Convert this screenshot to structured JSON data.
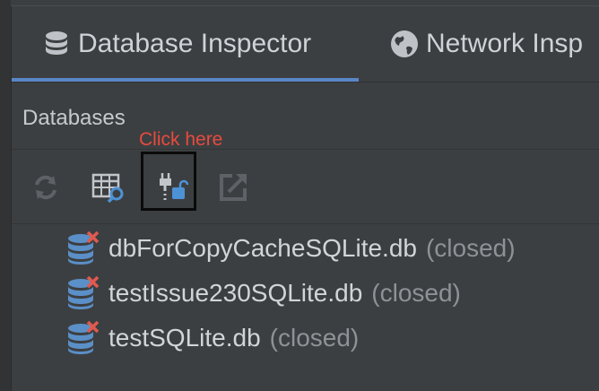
{
  "tabs": [
    {
      "label": "Database Inspector",
      "icon": "database-icon",
      "active": true
    },
    {
      "label": "Network Insp",
      "icon": "globe-icon",
      "active": false
    }
  ],
  "section": {
    "title": "Databases"
  },
  "annotation": {
    "text": "Click here",
    "color": "#e84a3e"
  },
  "toolbar": {
    "buttons": [
      {
        "name": "refresh",
        "icon": "refresh-icon",
        "enabled": false
      },
      {
        "name": "run-query",
        "icon": "table-search-icon",
        "enabled": true
      },
      {
        "name": "keep-connections-open",
        "icon": "plug-unlock-icon",
        "enabled": true
      },
      {
        "name": "export",
        "icon": "export-icon",
        "enabled": false
      }
    ]
  },
  "databases": [
    {
      "name": "dbForCopyCacheSQLite.db",
      "status": "(closed)"
    },
    {
      "name": "testIssue230SQLite.db",
      "status": "(closed)"
    },
    {
      "name": "testSQLite.db",
      "status": "(closed)"
    }
  ],
  "colors": {
    "accent": "#5a86c8",
    "annotation": "#e84a3e",
    "db_icon": "#5b8fc7",
    "close_x": "#e05a4f"
  }
}
